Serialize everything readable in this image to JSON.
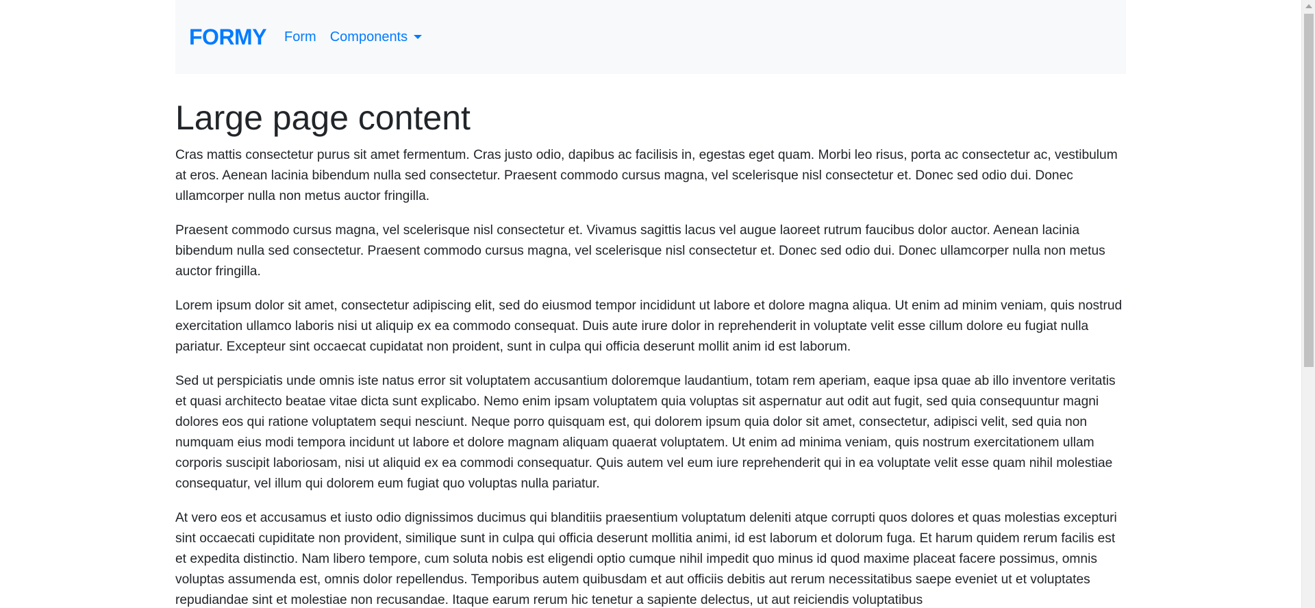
{
  "navbar": {
    "brand": "FORMY",
    "links": [
      {
        "label": "Form"
      },
      {
        "label": "Components"
      }
    ]
  },
  "main": {
    "title": "Large page content",
    "paragraphs": [
      "Cras mattis consectetur purus sit amet fermentum. Cras justo odio, dapibus ac facilisis in, egestas eget quam. Morbi leo risus, porta ac consectetur ac, vestibulum at eros. Aenean lacinia bibendum nulla sed consectetur. Praesent commodo cursus magna, vel scelerisque nisl consectetur et. Donec sed odio dui. Donec ullamcorper nulla non metus auctor fringilla.",
      "Praesent commodo cursus magna, vel scelerisque nisl consectetur et. Vivamus sagittis lacus vel augue laoreet rutrum faucibus dolor auctor. Aenean lacinia bibendum nulla sed consectetur. Praesent commodo cursus magna, vel scelerisque nisl consectetur et. Donec sed odio dui. Donec ullamcorper nulla non metus auctor fringilla.",
      "Lorem ipsum dolor sit amet, consectetur adipiscing elit, sed do eiusmod tempor incididunt ut labore et dolore magna aliqua. Ut enim ad minim veniam, quis nostrud exercitation ullamco laboris nisi ut aliquip ex ea commodo consequat. Duis aute irure dolor in reprehenderit in voluptate velit esse cillum dolore eu fugiat nulla pariatur. Excepteur sint occaecat cupidatat non proident, sunt in culpa qui officia deserunt mollit anim id est laborum.",
      "Sed ut perspiciatis unde omnis iste natus error sit voluptatem accusantium doloremque laudantium, totam rem aperiam, eaque ipsa quae ab illo inventore veritatis et quasi architecto beatae vitae dicta sunt explicabo. Nemo enim ipsam voluptatem quia voluptas sit aspernatur aut odit aut fugit, sed quia consequuntur magni dolores eos qui ratione voluptatem sequi nesciunt. Neque porro quisquam est, qui dolorem ipsum quia dolor sit amet, consectetur, adipisci velit, sed quia non numquam eius modi tempora incidunt ut labore et dolore magnam aliquam quaerat voluptatem. Ut enim ad minima veniam, quis nostrum exercitationem ullam corporis suscipit laboriosam, nisi ut aliquid ex ea commodi consequatur. Quis autem vel eum iure reprehenderit qui in ea voluptate velit esse quam nihil molestiae consequatur, vel illum qui dolorem eum fugiat quo voluptas nulla pariatur.",
      "At vero eos et accusamus et iusto odio dignissimos ducimus qui blanditiis praesentium voluptatum deleniti atque corrupti quos dolores et quas molestias excepturi sint occaecati cupiditate non provident, similique sunt in culpa qui officia deserunt mollitia animi, id est laborum et dolorum fuga. Et harum quidem rerum facilis est et expedita distinctio. Nam libero tempore, cum soluta nobis est eligendi optio cumque nihil impedit quo minus id quod maxime placeat facere possimus, omnis voluptas assumenda est, omnis dolor repellendus. Temporibus autem quibusdam et aut officiis debitis aut rerum necessitatibus saepe eveniet ut et voluptates repudiandae sint et molestiae non recusandae. Itaque earum rerum hic tenetur a sapiente delectus, ut aut reiciendis voluptatibus"
    ]
  },
  "colors": {
    "accent": "#007bff",
    "navbar_bg": "#f8f9fa",
    "text": "#212529"
  },
  "icons": {
    "components_dropdown": "caret-down-icon",
    "scroll_up": "scroll-up-arrow-icon"
  }
}
